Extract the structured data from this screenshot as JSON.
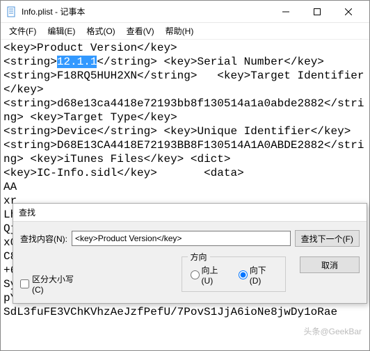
{
  "window": {
    "title": "Info.plist - 记事本"
  },
  "menu": {
    "file": "文件(F)",
    "edit": "编辑(E)",
    "format": "格式(O)",
    "view": "查看(V)",
    "help": "帮助(H)"
  },
  "plist": {
    "k_product_version_open": "<key>",
    "k_product_version_text": "Product Version",
    "k_product_version_close": "</key>",
    "v_product_version_open": "<string>",
    "v_product_version_sel": "12.1.1",
    "v_product_version_close": "</string>",
    "k_serial_open": "<key>",
    "k_serial_text": "Serial Number",
    "k_serial_close": "</key>",
    "v_serial_open": "<string>",
    "v_serial_text": "F18RQ5HUH2XN",
    "v_serial_close": "</string>",
    "k_target_id_open": "<key>",
    "k_target_id_text": "Target Identifier",
    "k_target_id_close": "</key>",
    "v_target_id_open": "<string>",
    "v_target_id_text": "d68e13ca4418e72193bb8f130514a1a0abde2882",
    "v_target_id_close": "</string>",
    "k_target_type_open": "<key>",
    "k_target_type_text": "Target Type",
    "k_target_type_close": "</key>",
    "v_target_type_open": "<string>",
    "v_target_type_text": "Device",
    "v_target_type_close": "</string>",
    "k_unique_id_open": "<key>",
    "k_unique_id_text": "Unique Identifier",
    "k_unique_id_close": "</key>",
    "v_unique_id_open": "<string>",
    "v_unique_id_text": "D68E13CA4418E72193BB8F130514A1A0ABDE2882",
    "v_unique_id_close": "</string>",
    "k_itunes_open": "<key>",
    "k_itunes_text": "iTunes Files",
    "k_itunes_close": "</key>",
    "dict_open": "<dict>",
    "k_icinfo_open": "<key>",
    "k_icinfo_text": "IC-Info.sidl",
    "k_icinfo_close": "</key>",
    "data_open": "<data>",
    "obscured_lines": "AA\nxr\nLh\nQj\nx0\nC8\n+6\nSy\npYWnXrNVDI",
    "last_line": "SdL3fuFE3VChKVhzAeJzfPefU/7PovS1JjA6ioNe8jwDy1oRae"
  },
  "find": {
    "title": "查找",
    "label": "查找内容(N):",
    "value": "<key>Product Version</key>",
    "find_next": "查找下一个(F)",
    "cancel": "取消",
    "match_case": "区分大小写(C)",
    "direction_legend": "方向",
    "dir_up": "向上(U)",
    "dir_down": "向下(D)"
  },
  "watermark": "头条@GeekBar"
}
